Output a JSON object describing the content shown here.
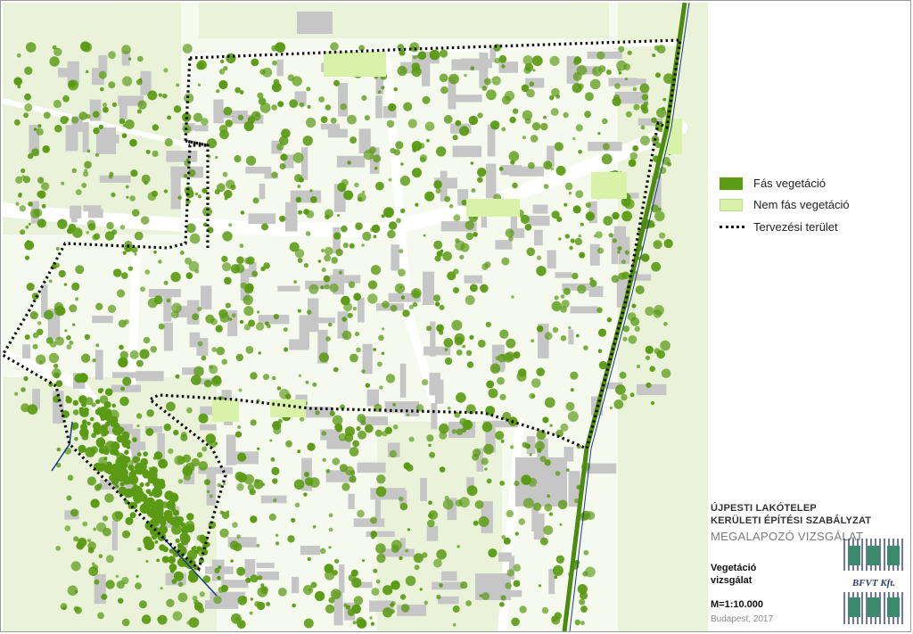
{
  "legend": {
    "items": [
      {
        "label": "Fás vegetáció",
        "color": "#5a9a14"
      },
      {
        "label": "Nem fás vegetáció",
        "color": "#d8f2a8"
      },
      {
        "label": "Tervezési terület",
        "color": "#111111"
      }
    ]
  },
  "title_block": {
    "project_line1": "ÚJPESTI LAKÓTELEP",
    "project_line2": "KERÜLETI ÉPÍTÉSI SZABÁLYZAT",
    "subtitle": "MEGALAPOZÓ VIZSGÁLAT",
    "topic_line1": "Vegetáció",
    "topic_line2": "vizsgálat",
    "scale": "M=1:10.000",
    "place_year": "Budapest, 2017",
    "logo_text": "BFVT Kft."
  },
  "colors": {
    "woody": "#5a9a14",
    "non_woody": "#d8f2a8",
    "building": "#c8c8c8",
    "boundary": "#111111",
    "water": "#1a3a8a"
  }
}
